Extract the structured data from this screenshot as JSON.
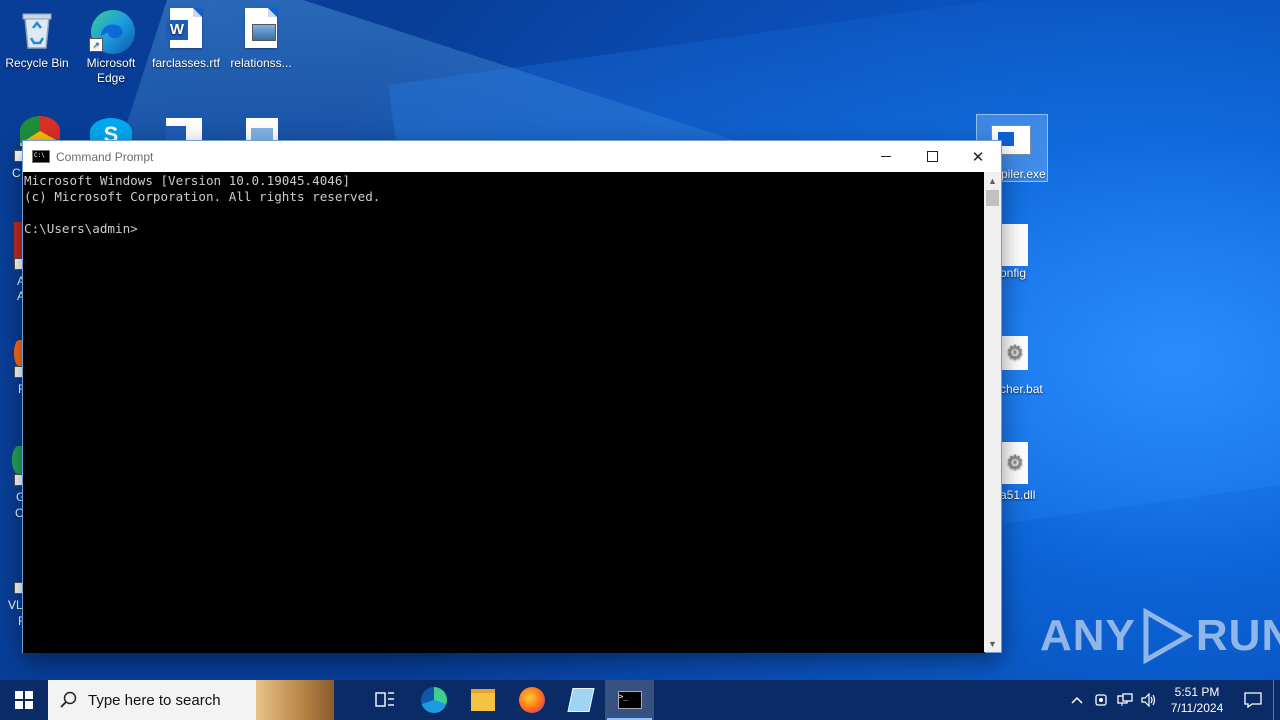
{
  "desktop": {
    "icons": [
      {
        "label": "Recycle Bin",
        "icon": "recycle-bin-icon"
      },
      {
        "label": "Microsoft Edge",
        "icon": "edge-icon"
      },
      {
        "label": "farclasses.rtf",
        "icon": "word-document-icon"
      },
      {
        "label": "relationss...",
        "icon": "image-file-icon"
      }
    ],
    "right_icons": [
      {
        "label": "piler.exe",
        "icon": "exe-window-icon"
      },
      {
        "label": "onfig",
        "icon": "blank-file-icon"
      },
      {
        "label": "cher.bat",
        "icon": "batch-file-icon"
      },
      {
        "label": "a51.dll",
        "icon": "dll-file-icon"
      }
    ],
    "left_partial_labels": [
      "C",
      "A",
      "A",
      "F",
      "G",
      "C",
      "VLC",
      "F"
    ]
  },
  "window": {
    "title": "Command Prompt",
    "minimize": "—",
    "maximize": "☐",
    "close": "✕",
    "console_lines": [
      "Microsoft Windows [Version 10.0.19045.4046]",
      "(c) Microsoft Corporation. All rights reserved.",
      "",
      "C:\\Users\\admin>"
    ]
  },
  "taskbar": {
    "search_placeholder": "Type here to search",
    "apps": [
      "task-view-icon",
      "edge-icon",
      "file-explorer-icon",
      "firefox-icon",
      "notepad-icon",
      "command-prompt-icon"
    ],
    "clock_time": "5:51 PM",
    "clock_date": "7/11/2024"
  },
  "watermark": {
    "text_left": "ANY",
    "text_right": "RUN"
  },
  "colors": {
    "accent": "#0b63d6",
    "taskbar": "#0b2b66",
    "console_bg": "#000000",
    "console_fg": "#cccccc"
  }
}
